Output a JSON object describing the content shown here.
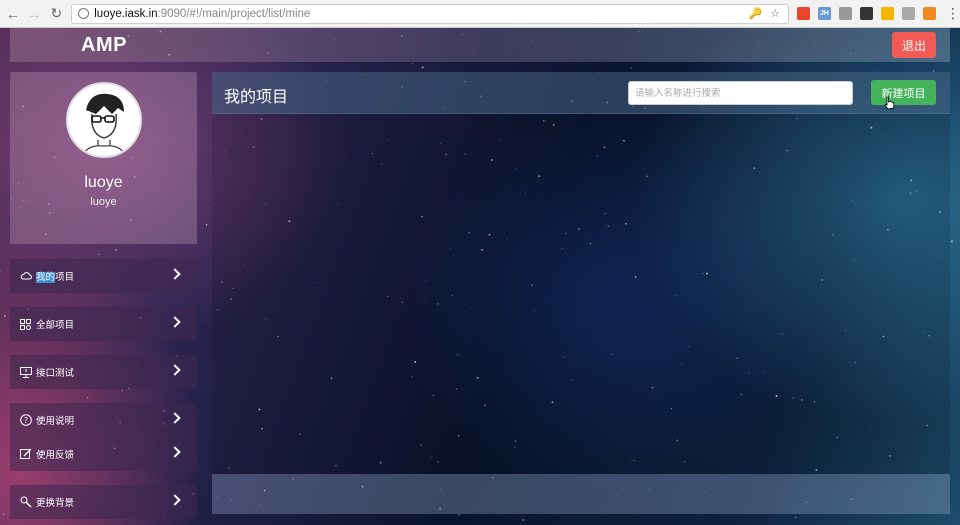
{
  "browser": {
    "url_host": "luoye.iask.in",
    "url_path": ":9090/#!/main/project/list/mine",
    "extensions": [
      {
        "name": "opera-icon",
        "color": "#e8452c",
        "text": ""
      },
      {
        "name": "jh-extension-icon",
        "color": "#6a9ad6",
        "text": "JH"
      },
      {
        "name": "circle-extension-icon",
        "color": "#9a9a9a",
        "text": ""
      },
      {
        "name": "qr-extension-icon",
        "color": "#333333",
        "text": ""
      },
      {
        "name": "yellow-extension-icon",
        "color": "#f5b400",
        "text": ""
      },
      {
        "name": "android-extension-icon",
        "color": "#a8a8a8",
        "text": ""
      },
      {
        "name": "chart-extension-icon",
        "color": "#f08a1e",
        "text": ""
      }
    ]
  },
  "header": {
    "logo": "AMP",
    "logout_label": "退出"
  },
  "profile": {
    "name": "luoye",
    "username": "luoye"
  },
  "menu": {
    "my_projects": {
      "highlight": "我的",
      "rest": "项目"
    },
    "all_projects": "全部项目",
    "api_test": "接口测试",
    "usage_guide": "使用说明",
    "feedback": "使用反馈",
    "change_background": "更换背景"
  },
  "main": {
    "title": "我的项目",
    "search_placeholder": "请输入名称进行搜索",
    "new_project_label": "新建项目"
  },
  "colors": {
    "logout": "#f25b55",
    "new_project": "#44b35c",
    "active_highlight": "#3d8fd6"
  }
}
